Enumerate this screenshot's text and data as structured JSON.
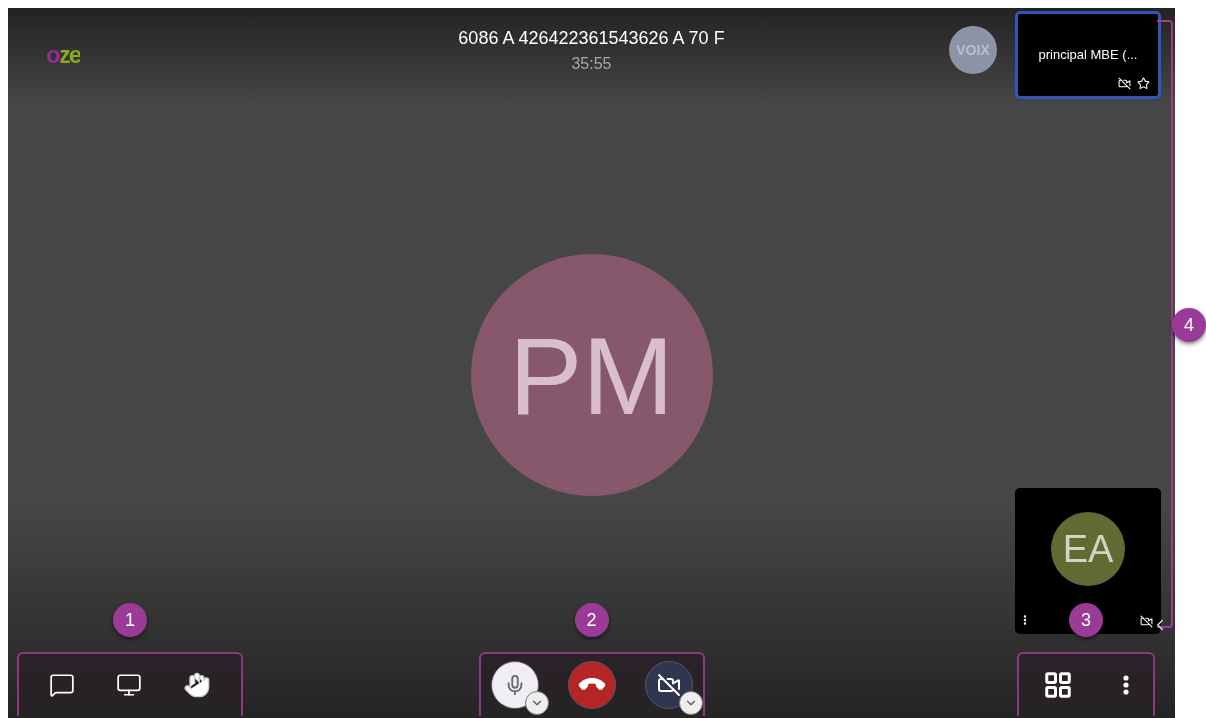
{
  "logo": {
    "text": "oze"
  },
  "call": {
    "title": "6086 A 426422361543626 A 70 F",
    "timer": "35:55"
  },
  "voice_badge": "VOIX",
  "speaker": {
    "initials": "PM",
    "color": "#87586b"
  },
  "thumbnails": [
    {
      "name": "principal MBE (...",
      "selected": true,
      "camera_off": true,
      "starred": false,
      "kind": "named"
    },
    {
      "initials": "EA",
      "color": "#5f6b32",
      "selected": false,
      "camera_off": true,
      "kind": "avatar"
    }
  ],
  "toolbars": [
    {
      "marker": "1",
      "buttons": [
        {
          "kind": "chat"
        },
        {
          "kind": "screen"
        },
        {
          "kind": "hand"
        }
      ]
    },
    {
      "marker": "2",
      "buttons": [
        {
          "kind": "mic",
          "muted": false
        },
        {
          "kind": "hangup"
        },
        {
          "kind": "camera",
          "muted": true
        }
      ]
    },
    {
      "marker": "3",
      "buttons": [
        {
          "kind": "grid"
        },
        {
          "kind": "more"
        }
      ]
    }
  ],
  "side_marker": "4"
}
